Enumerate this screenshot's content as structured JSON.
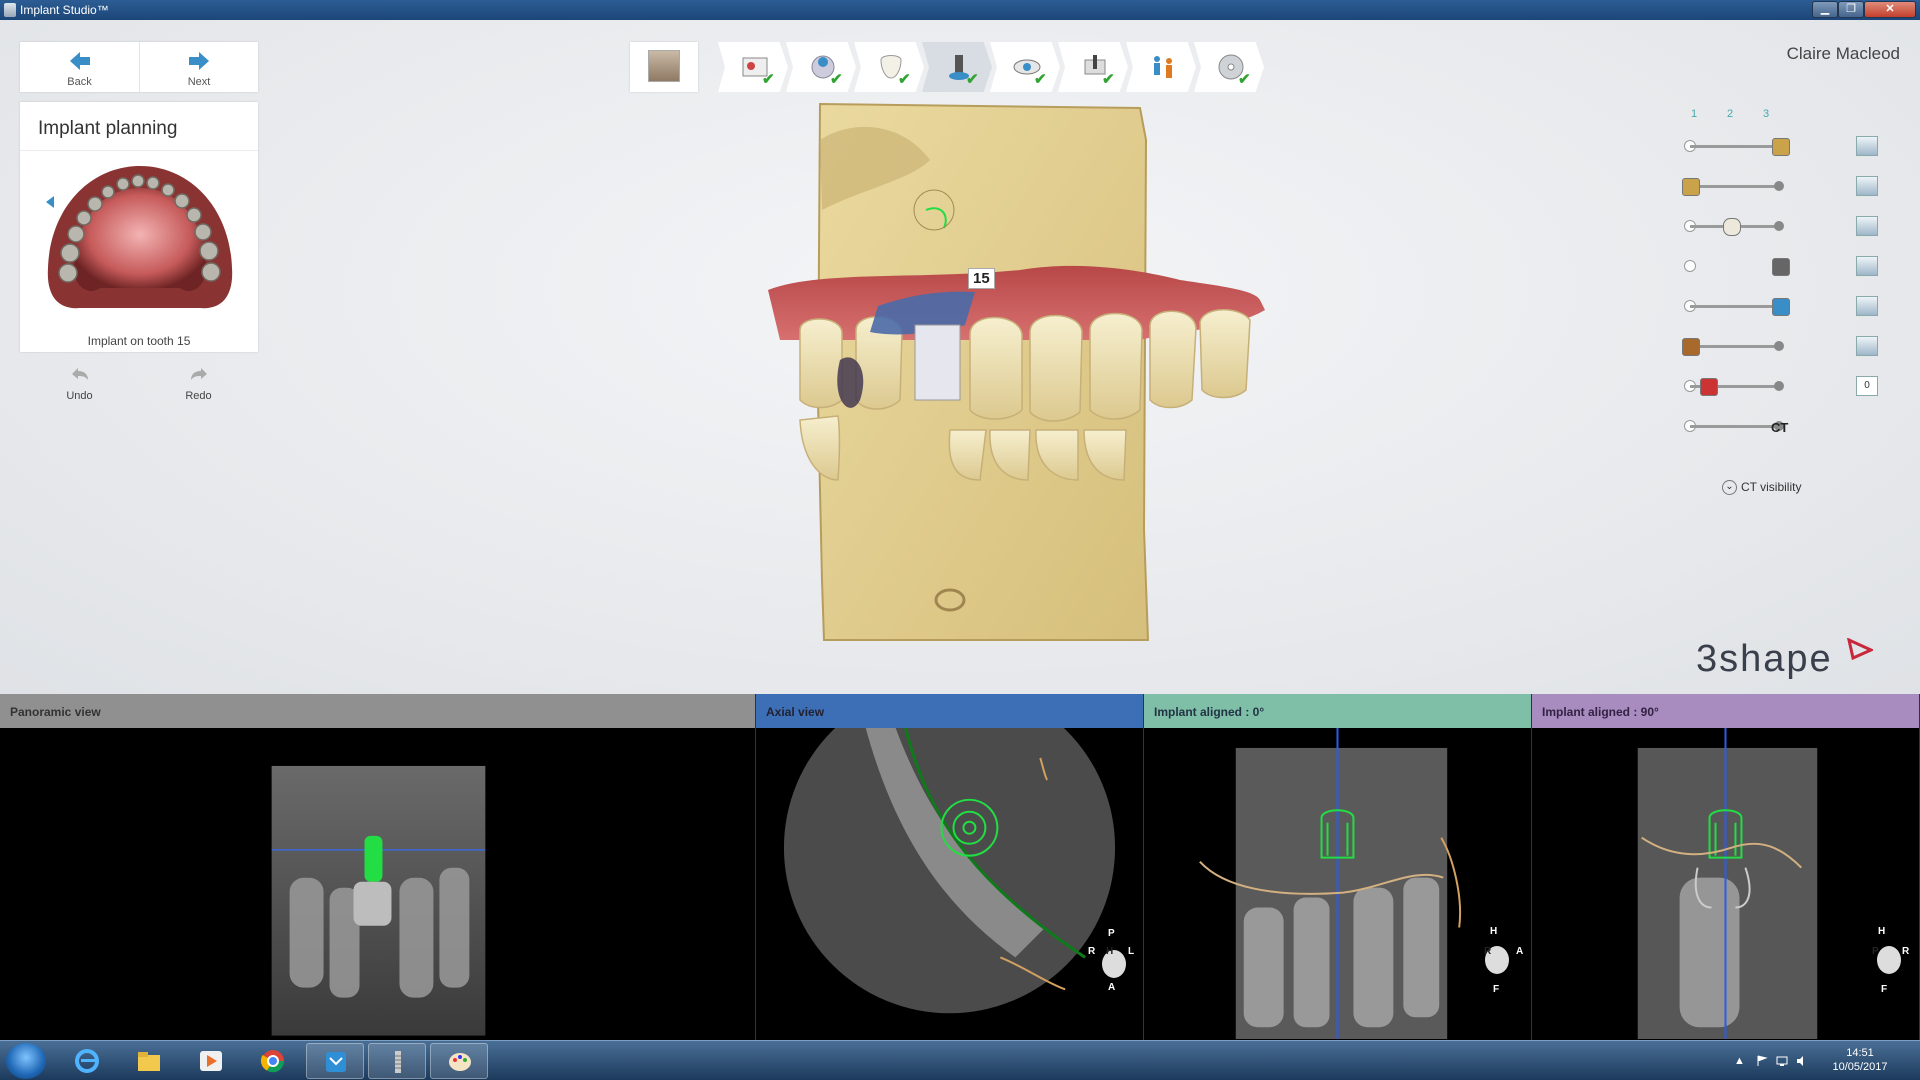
{
  "window": {
    "title": "Implant Studio™"
  },
  "nav": {
    "back_label": "Back",
    "next_label": "Next"
  },
  "planning": {
    "title": "Implant planning",
    "caption": "Implant on tooth 15"
  },
  "history": {
    "undo_label": "Undo",
    "redo_label": "Redo"
  },
  "workflow": {
    "steps": [
      {
        "icon": "patient-photo-icon",
        "done": false
      },
      {
        "icon": "patient-info-icon",
        "done": true
      },
      {
        "icon": "scan-import-icon",
        "done": true
      },
      {
        "icon": "tooth-icon",
        "done": true
      },
      {
        "icon": "implant-planning-icon",
        "done": true,
        "active": true
      },
      {
        "icon": "eye-view-icon",
        "done": true
      },
      {
        "icon": "guide-design-icon",
        "done": true
      },
      {
        "icon": "people-icon",
        "done": false
      },
      {
        "icon": "disc-export-icon",
        "done": true
      }
    ]
  },
  "user": {
    "name": "Claire Macleod"
  },
  "model": {
    "tooth_label": "15"
  },
  "layers": {
    "columns": [
      "1",
      "2",
      "3"
    ],
    "rows": [
      {
        "icon": "crown-icon",
        "value": 1.0,
        "track": true
      },
      {
        "icon": "abutment-icon",
        "value": 0.0,
        "track": true
      },
      {
        "icon": "tooth-icon",
        "value": 0.45,
        "track": true
      },
      {
        "icon": "sleeve-icon",
        "value": 1.0,
        "track": false
      },
      {
        "icon": "implant-cylinder-icon",
        "value": 1.0,
        "track": true
      },
      {
        "icon": "bone-cylinder-icon",
        "value": 0.0,
        "track": true
      },
      {
        "icon": "scissors-icon",
        "value": 0.2,
        "track": true
      },
      {
        "icon": "ct-icon",
        "value": 1.0,
        "track": true,
        "label": "CT"
      }
    ],
    "side_buttons": [
      "view-cube-icon",
      "view-cube-icon",
      "view-cube-icon",
      "view-cube-icon",
      "view-cube-icon",
      "view-cube-icon",
      "comment-icon"
    ],
    "comment_count": "0",
    "ct_visibility_label": "CT visibility"
  },
  "brand": {
    "logo_text": "3shape"
  },
  "views": {
    "panoramic": {
      "title": "Panoramic view"
    },
    "axial": {
      "title": "Axial view",
      "orient": {
        "top": "P",
        "left": "R",
        "center": "H",
        "right": "L",
        "bottom": "A"
      }
    },
    "aligned0": {
      "title": "Implant aligned : 0°",
      "orient": {
        "top": "H",
        "left": "R",
        "right": "A",
        "bottom": "F"
      }
    },
    "aligned90": {
      "title": "Implant aligned : 90°",
      "orient": {
        "top": "H",
        "left": "P",
        "right": "R",
        "bottom": "F"
      }
    }
  },
  "taskbar": {
    "items": [
      "ie-icon",
      "explorer-icon",
      "media-player-icon",
      "chrome-icon",
      "3shape-app-icon",
      "implant-studio-icon",
      "paint-icon"
    ],
    "time": "14:51",
    "date": "10/05/2017"
  },
  "colors": {
    "accent": "#3a8ec8",
    "check": "#33a333",
    "gum": "#c65a5a",
    "bone": "#e6d198",
    "guide_green": "#22dd44",
    "axis_blue": "#2b5ce6"
  }
}
